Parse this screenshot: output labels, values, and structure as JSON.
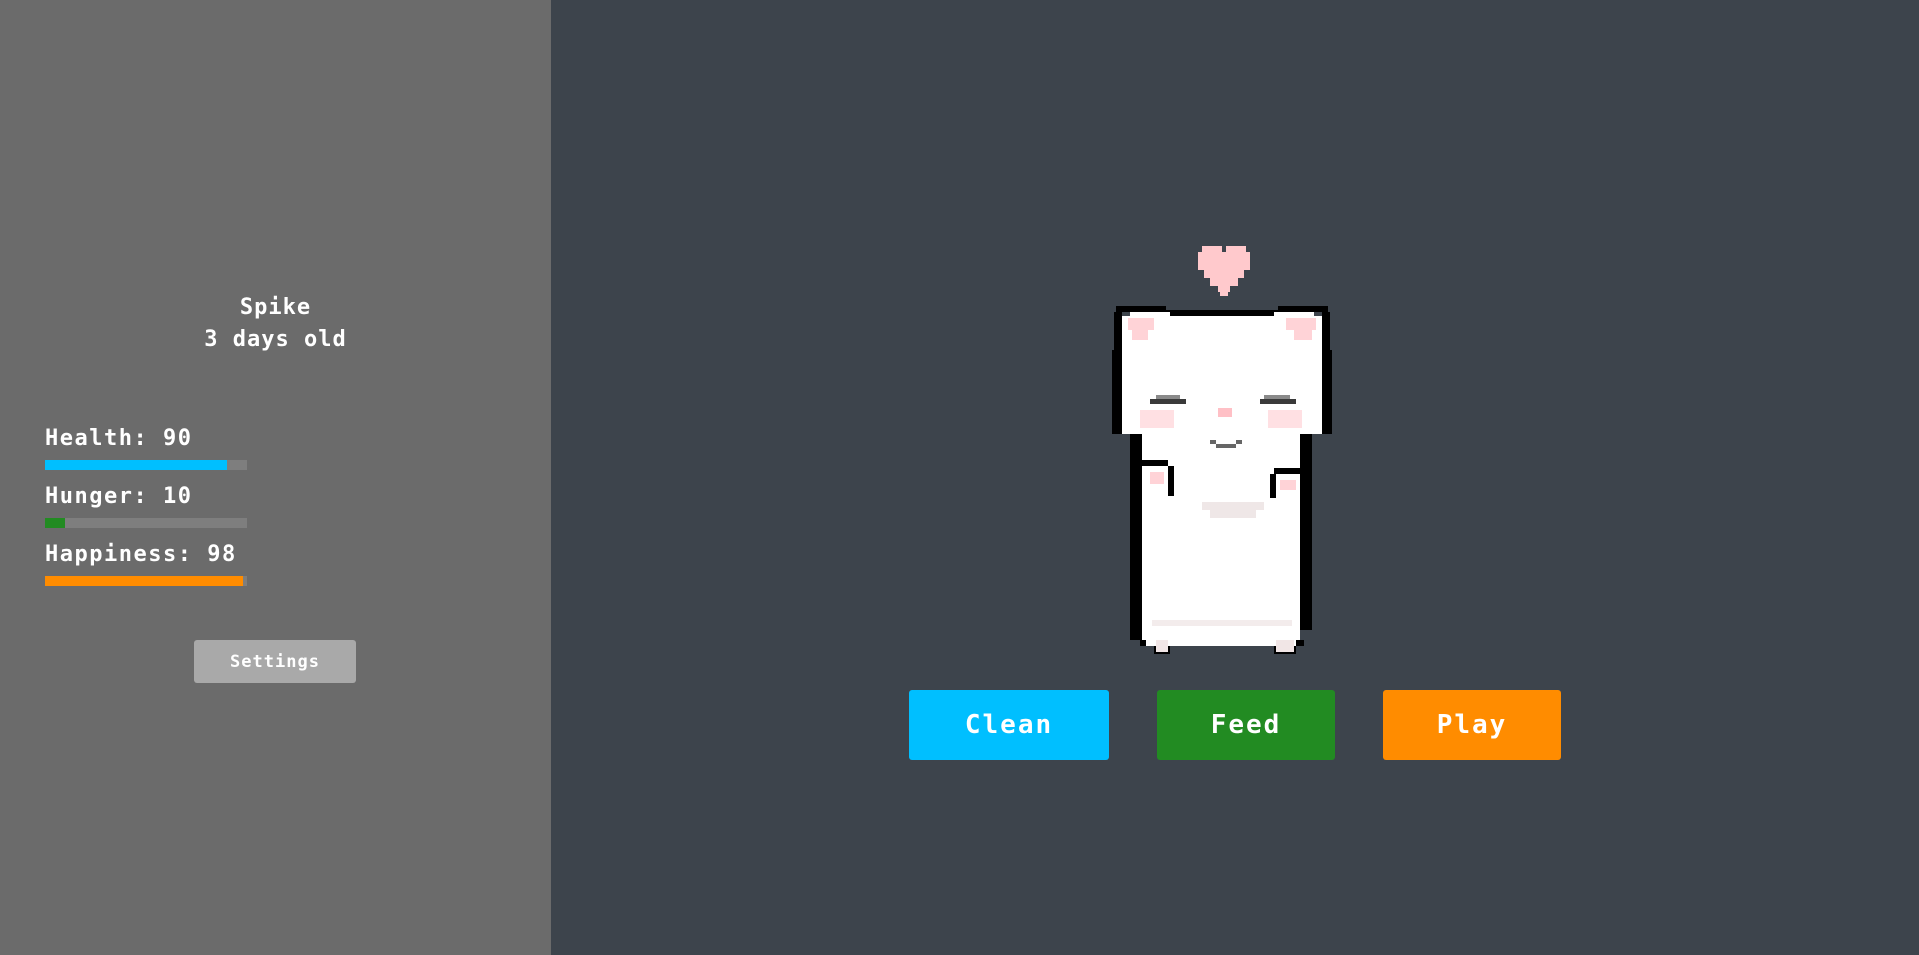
{
  "pet": {
    "name": "Spike",
    "age": "3 days old"
  },
  "stats": [
    {
      "label": "Health:",
      "value": "90",
      "fraction": 0.9,
      "color": "#00bfff"
    },
    {
      "label": "Hunger:",
      "value": "10",
      "fraction": 0.1,
      "color": "#228b22"
    },
    {
      "label": "Happiness:",
      "value": "98",
      "fraction": 0.98,
      "color": "#ff8c00"
    }
  ],
  "settings_label": "Settings",
  "actions": {
    "clean": {
      "label": "Clean",
      "color": "#00bfff"
    },
    "feed": {
      "label": "Feed",
      "color": "#228b22"
    },
    "play": {
      "label": "Play",
      "color": "#ff8c00"
    }
  },
  "colors": {
    "sidebar_bg": "#6b6b6b",
    "main_bg": "#3d444c",
    "heart": "#ffc9cc"
  },
  "icons": {
    "pet": "white-pixel-cat-sprite",
    "mood": "heart-icon"
  }
}
